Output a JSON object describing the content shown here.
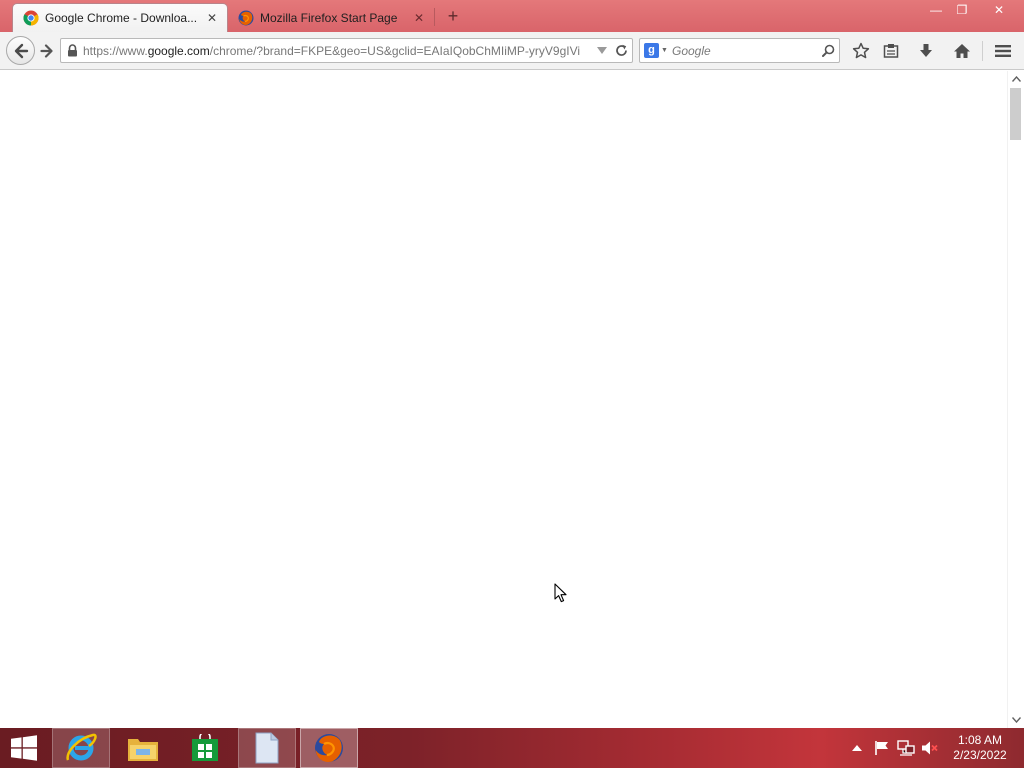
{
  "window": {
    "minimize_symbol": "—",
    "maximize_symbol": "❐",
    "close_symbol": "✕"
  },
  "tabs": [
    {
      "title": "Google Chrome - Downloa...",
      "icon": "chrome-icon",
      "active": true,
      "close_symbol": "✕"
    },
    {
      "title": "Mozilla Firefox Start Page",
      "icon": "firefox-icon",
      "active": false,
      "close_symbol": "✕"
    }
  ],
  "new_tab_symbol": "+",
  "navbar": {
    "url_prefix": "https://www.",
    "url_host": "google.com",
    "url_rest": "/chrome/?brand=FKPE&geo=US&gclid=EAIaIQobChMIiMP-yryV9gIVi",
    "search": {
      "engine_letter": "g",
      "placeholder": "Google"
    }
  },
  "taskbar": {
    "apps": [
      {
        "name": "Internet Explorer",
        "icon": "ie-icon"
      },
      {
        "name": "File Explorer",
        "icon": "folder-icon"
      },
      {
        "name": "Store",
        "icon": "store-icon"
      },
      {
        "name": "Document",
        "icon": "document-icon"
      },
      {
        "name": "Firefox",
        "icon": "firefox-icon",
        "active": true
      }
    ],
    "clock": {
      "time": "1:08 AM",
      "date": "2/23/2022"
    }
  },
  "colors": {
    "titlebar": "#d9646a",
    "toolbar": "#f2f2f2",
    "taskbar": "#a82c33"
  }
}
